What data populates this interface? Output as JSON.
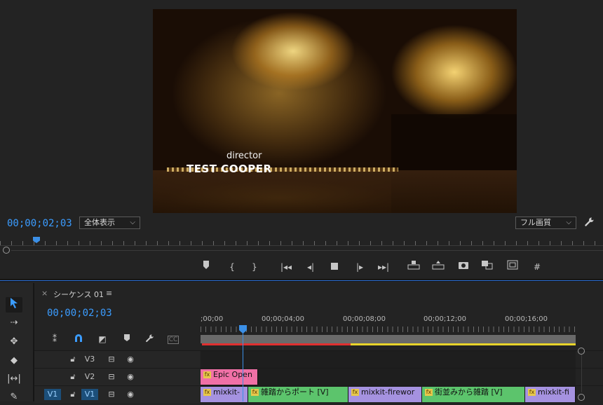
{
  "program_monitor": {
    "credit_role": "director",
    "credit_name": "TEST COOPER",
    "timecode": "00;00;02;03",
    "zoom": "全体表示",
    "quality": "フル画質"
  },
  "transport_icons": [
    "marker-icon",
    "mark-in-icon",
    "mark-out-icon",
    "go-to-in-icon",
    "step-back-icon",
    "stop-icon",
    "step-forward-icon",
    "go-to-out-icon",
    "lift-icon",
    "extract-icon",
    "export-frame-icon",
    "comparison-view-icon",
    "safe-margins-icon",
    "timecode-overlay-icon"
  ],
  "timeline": {
    "close": "×",
    "sequence_name": "シーケンス 01",
    "menu": "≡",
    "timecode": "00;00;02;03",
    "ruler": [
      ";00;00",
      "00;00;04;00",
      "00;00;08;00",
      "00;00;12;00",
      "00;00;16;00"
    ],
    "tracks": [
      {
        "source": "",
        "name": "V3"
      },
      {
        "source": "",
        "name": "V2"
      },
      {
        "source": "V1",
        "name": "V1"
      }
    ],
    "clips": {
      "v2": [
        {
          "label": "Epic Open",
          "color": "#f070a6"
        }
      ],
      "v1": [
        {
          "label": "mixkit-",
          "color": "#a592e0"
        },
        {
          "label": "雑踏からポート [V]",
          "color": "#5cc46c"
        },
        {
          "label": "mixkit-firewor",
          "color": "#a592e0"
        },
        {
          "label": "街並みから雑踏 [V]",
          "color": "#5cc46c"
        },
        {
          "label": "mixkit-fi",
          "color": "#a592e0"
        }
      ]
    }
  },
  "colors": {
    "accent": "#3b9cff",
    "render_red": "#e02f2f",
    "render_yellow": "#e8d42a"
  }
}
